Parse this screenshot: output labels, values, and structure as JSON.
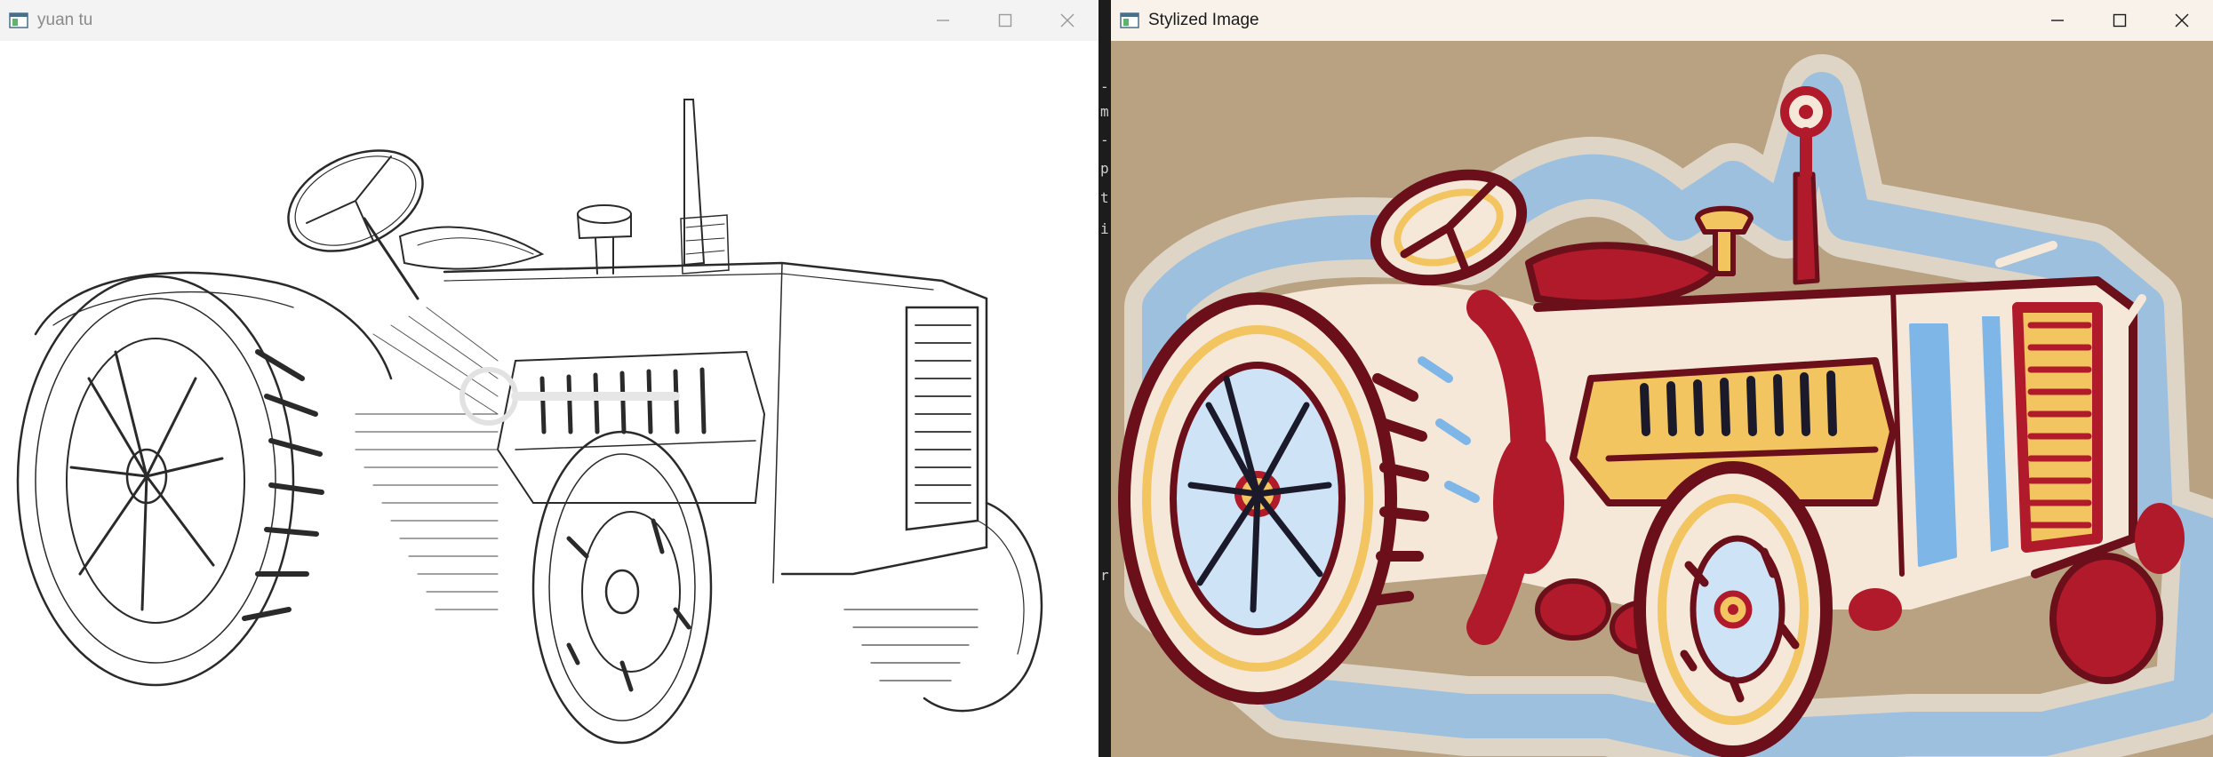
{
  "windows": {
    "original": {
      "title": "yuan tu",
      "icon": "opencv-window-icon",
      "controls": {
        "minimize_icon": "minimize-icon",
        "maximize_icon": "maximize-icon",
        "close_icon": "close-icon"
      },
      "content": "pencil-sketch-tractor"
    },
    "stylized": {
      "title": "Stylized Image",
      "icon": "opencv-window-icon",
      "controls": {
        "minimize_icon": "minimize-icon",
        "maximize_icon": "maximize-icon",
        "close_icon": "close-icon"
      },
      "content": "stylized-painted-tractor"
    }
  },
  "background_terminal": {
    "glyphs": [
      "-",
      "m",
      "-",
      "p",
      "t",
      "i",
      "r"
    ]
  },
  "colors": {
    "stylized_background": "#b8a282",
    "sketch_background": "#ffffff",
    "paint_red": "#b01a2a",
    "paint_blue": "#7fb6e8",
    "paint_yellow": "#f2c560"
  }
}
